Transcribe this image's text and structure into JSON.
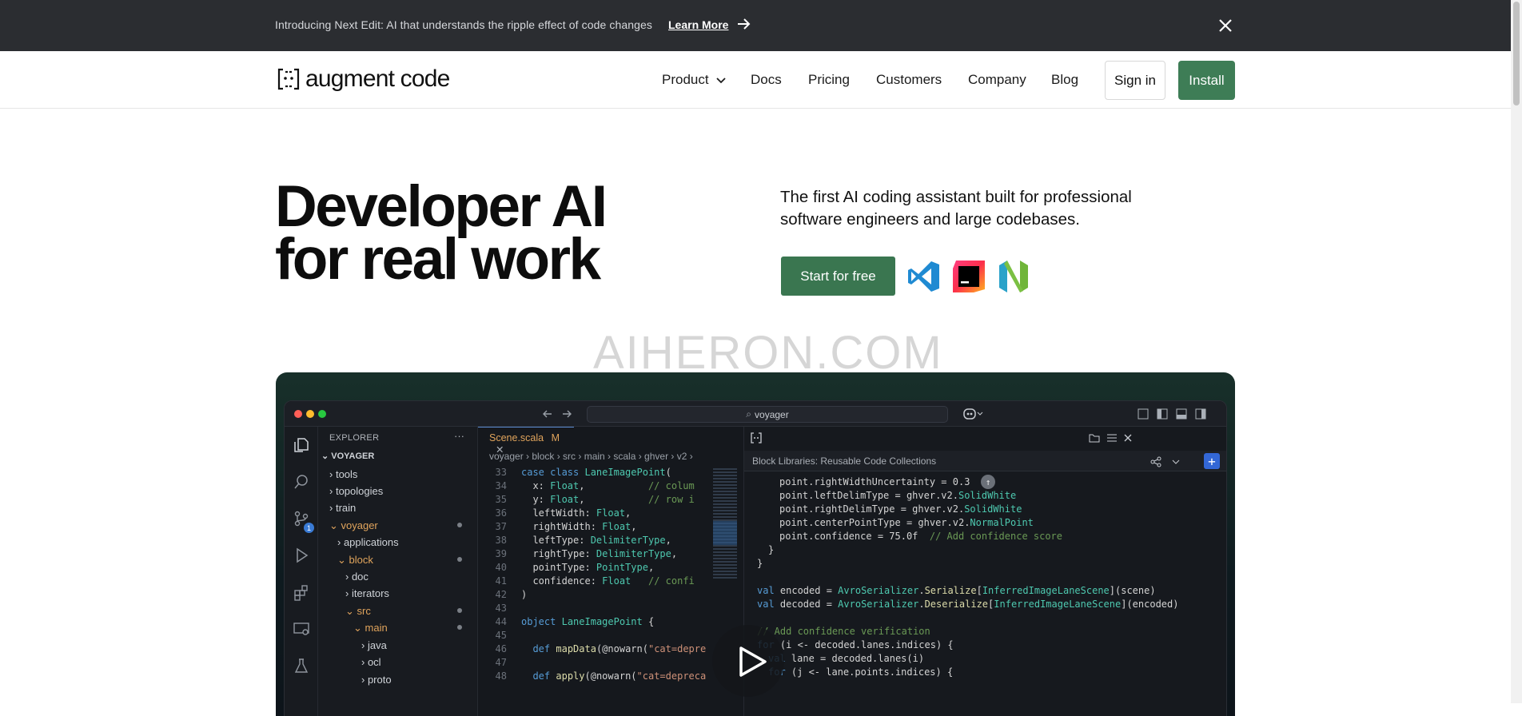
{
  "banner": {
    "text": "Introducing Next Edit: AI that understands the ripple effect of code changes",
    "link_label": "Learn More"
  },
  "nav": {
    "logo_text": "augment code",
    "items": [
      "Product",
      "Docs",
      "Pricing",
      "Customers",
      "Company",
      "Blog"
    ],
    "signin_label": "Sign in",
    "install_label": "Install"
  },
  "hero": {
    "title_line1": "Developer AI",
    "title_line2": "for real work",
    "subtitle": "The first AI coding assistant built for professional software engineers and large codebases.",
    "cta_label": "Start for free"
  },
  "watermark": "AIHERON.COM",
  "ide": {
    "search_text": "voyager",
    "explorer_title": "EXPLORER",
    "root": "VOYAGER",
    "tree": [
      "tools",
      "topologies",
      "train",
      "voyager",
      "applications",
      "block",
      "doc",
      "iterators",
      "src",
      "main",
      "java",
      "ocl",
      "proto"
    ],
    "tab_label": "Scene.scala",
    "tab_modifier": "M",
    "breadcrumbs": "voyager › block › src › main › scala › ghver › v2 ›",
    "chat_title": "Block Libraries: Reusable Code Collections",
    "source_control_badge": "1"
  },
  "colors": {
    "banner_bg": "#2b2d31",
    "brand_green": "#3e7d56"
  }
}
